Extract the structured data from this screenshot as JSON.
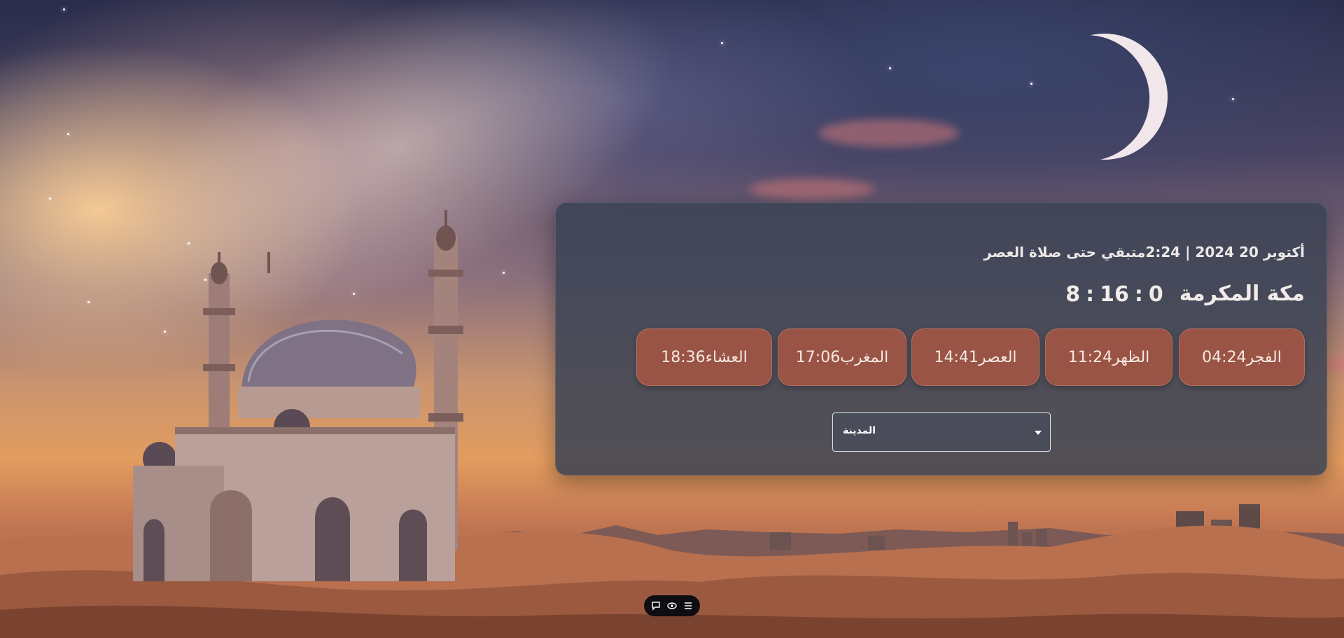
{
  "header": {
    "date": "أكتوبر 20 2024",
    "separator": "|",
    "remaining_time": "2:24",
    "remaining_text": "متبقي حتى صلاة العصر"
  },
  "location": {
    "city": "مكة المكرمة"
  },
  "countdown": {
    "hours": "8",
    "minutes": "16",
    "seconds": "0",
    "separator": ":"
  },
  "prayers": [
    {
      "name": "الفجر",
      "time": "04:24"
    },
    {
      "name": "الظهر",
      "time": "11:24"
    },
    {
      "name": "العصر",
      "time": "14:41"
    },
    {
      "name": "المغرب",
      "time": "17:06"
    },
    {
      "name": "العشاء",
      "time": "18:36"
    }
  ],
  "city_select": {
    "label": "المدينة"
  },
  "toolbar": {
    "icons": [
      "chat-bubble-icon",
      "eye-icon",
      "menu-lines-icon"
    ]
  },
  "colors": {
    "panel": "#3a4254",
    "prayer_button": "#9a5445",
    "text": "#f1ece8"
  }
}
